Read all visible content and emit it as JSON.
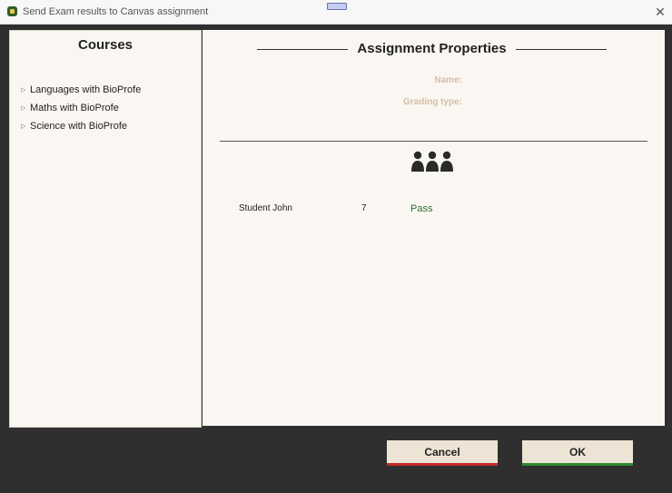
{
  "window": {
    "title": "Send Exam results to Canvas assignment",
    "close_glyph": "✕"
  },
  "courses": {
    "title": "Courses",
    "items": [
      {
        "label": "Languages with BioProfe"
      },
      {
        "label": "Maths with BioProfe"
      },
      {
        "label": "Science with BioProfe"
      }
    ],
    "expander_glyph": "▷"
  },
  "assignment": {
    "title": "Assignment Properties",
    "name_label": "Name:",
    "grading_type_label": "Grading type:",
    "students_icon": "students-group-icon"
  },
  "students": [
    {
      "name": "Student John",
      "score": "7",
      "result": "Pass"
    }
  ],
  "buttons": {
    "cancel": "Cancel",
    "ok": "OK"
  },
  "colors": {
    "cancel_accent": "#c42b2b",
    "ok_accent": "#2f8a2f",
    "pass_text": "#2f6b2f"
  }
}
